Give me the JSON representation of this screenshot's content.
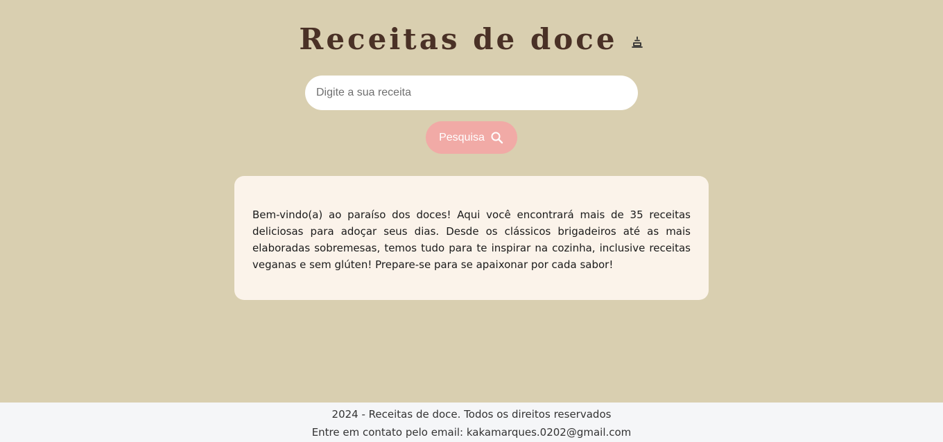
{
  "header": {
    "title": "Receitas de doce",
    "title_icon": "cake-icon"
  },
  "search": {
    "placeholder": "Digite a sua receita",
    "button_label": "Pesquisa",
    "button_icon": "search-icon"
  },
  "intro": {
    "text": "Bem-vindo(a) ao paraíso dos doces! Aqui você encontrará mais de 35 receitas deliciosas para adoçar seus dias. Desde os clássicos brigadeiros até as mais elaboradas sobremesas, temos tudo para te inspirar na cozinha, inclusive receitas veganas e sem glúten! Prepare-se para se apaixonar por cada sabor!"
  },
  "footer": {
    "copyright": "2024 - Receitas de doce. Todos os direitos reservados",
    "contact": "Entre em contato pelo email: kakamarques.0202@gmail.com"
  },
  "colors": {
    "background": "#d9cfb0",
    "title": "#4a3126",
    "button": "#f1aaa6",
    "card": "#fbf3ea",
    "footer_background": "#f5f6f8"
  }
}
